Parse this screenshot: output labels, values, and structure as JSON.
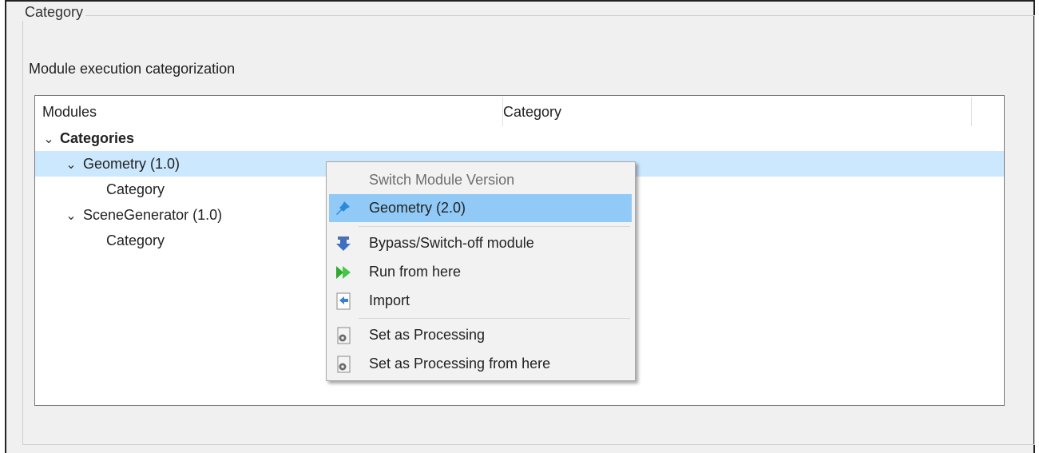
{
  "groupbox": {
    "title": "Category"
  },
  "section_label": "Module execution categorization",
  "tree": {
    "columns": [
      "Modules",
      "Category"
    ],
    "rows": [
      {
        "label": "Categories",
        "chevron": "⌄"
      },
      {
        "label": "Geometry (1.0)",
        "chevron": "⌄"
      },
      {
        "label": "Category"
      },
      {
        "label": "SceneGenerator (1.0)",
        "chevron": "⌄"
      },
      {
        "label": "Category"
      }
    ]
  },
  "context_menu": {
    "items": [
      {
        "label": "Switch Module Version",
        "disabled": true
      },
      {
        "label": "Geometry (2.0)",
        "icon": "pin-icon",
        "highlighted": true
      },
      {
        "label": "Bypass/Switch-off module",
        "icon": "bypass-arrow-icon"
      },
      {
        "label": "Run from here",
        "icon": "run-forward-icon"
      },
      {
        "label": "Import",
        "icon": "import-icon"
      },
      {
        "label": "Set as Processing",
        "icon": "processing-gear-icon"
      },
      {
        "label": "Set as Processing from here",
        "icon": "processing-gear-icon"
      }
    ]
  },
  "colors": {
    "selection": "#cce8ff",
    "menu_highlight": "#91c9f7",
    "frame_background": "#f0f0f0"
  }
}
